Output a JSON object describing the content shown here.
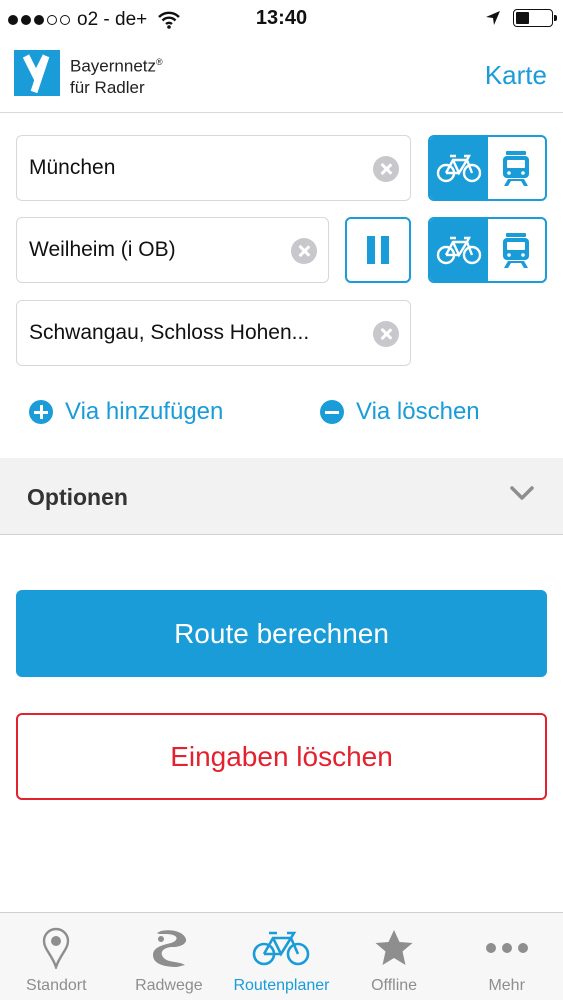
{
  "status_bar": {
    "carrier": "o2 - de+",
    "time": "13:40"
  },
  "header": {
    "brand_line1": "Bayernnetz",
    "brand_reg": "®",
    "brand_line2": "für Radler",
    "map_link": "Karte"
  },
  "route": {
    "start": {
      "value": "München",
      "mode": "bike"
    },
    "via": {
      "value": "Weilheim (i OB)",
      "mode": "bike"
    },
    "destination": {
      "value": "Schwangau, Schloss Hohen..."
    }
  },
  "via_actions": {
    "add": "Via hinzufügen",
    "remove": "Via löschen"
  },
  "options": {
    "label": "Optionen"
  },
  "actions": {
    "calculate": "Route berechnen",
    "clear": "Eingaben löschen"
  },
  "tabs": [
    {
      "label": "Standort",
      "icon": "location-pin-icon",
      "active": false
    },
    {
      "label": "Radwege",
      "icon": "bike-paths-icon",
      "active": false
    },
    {
      "label": "Routenplaner",
      "icon": "bicycle-icon",
      "active": true
    },
    {
      "label": "Offline",
      "icon": "star-icon",
      "active": false
    },
    {
      "label": "Mehr",
      "icon": "more-dots-icon",
      "active": false
    }
  ],
  "colors": {
    "accent": "#1a9cd8",
    "danger": "#e3212f",
    "options_bg": "#f2f2f2"
  }
}
